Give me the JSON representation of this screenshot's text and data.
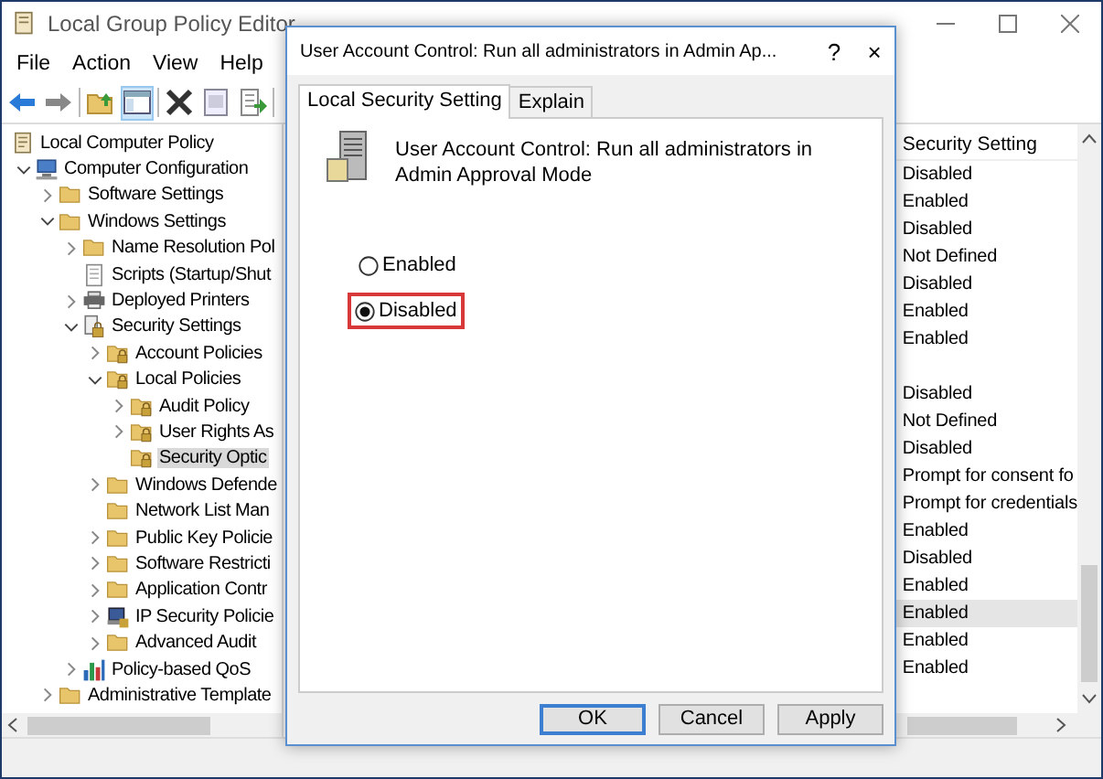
{
  "window": {
    "title": "Local Group Policy Editor"
  },
  "menu": [
    "File",
    "Action",
    "View",
    "Help"
  ],
  "toolbar": [
    {
      "kind": "back"
    },
    {
      "kind": "forward"
    },
    {
      "kind": "sep"
    },
    {
      "kind": "up"
    },
    {
      "kind": "tree",
      "selected": true
    },
    {
      "kind": "sep"
    },
    {
      "kind": "delete"
    },
    {
      "kind": "properties"
    },
    {
      "kind": "export"
    },
    {
      "kind": "sep"
    }
  ],
  "tree": [
    {
      "label": "Local Computer Policy",
      "kind": "policy",
      "selected": false,
      "children": [
        {
          "label": "Computer Configuration",
          "kind": "computer",
          "expanded": true,
          "selected": false,
          "children": [
            {
              "label": "Software Settings",
              "kind": "folder",
              "expanded": false,
              "selected": false
            },
            {
              "label": "Windows Settings",
              "kind": "folder",
              "expanded": true,
              "selected": false,
              "children": [
                {
                  "label": "Name Resolution Pol",
                  "kind": "folder",
                  "expanded": false,
                  "selected": false
                },
                {
                  "label": "Scripts (Startup/Shut",
                  "kind": "script",
                  "selected": false
                },
                {
                  "label": "Deployed Printers",
                  "kind": "printer",
                  "expanded": false,
                  "selected": false
                },
                {
                  "label": "Security Settings",
                  "kind": "lock-doc",
                  "expanded": true,
                  "selected": false,
                  "children": [
                    {
                      "label": "Account Policies",
                      "kind": "lock-folder",
                      "expanded": false,
                      "selected": false
                    },
                    {
                      "label": "Local Policies",
                      "kind": "lock-folder",
                      "expanded": true,
                      "selected": false,
                      "children": [
                        {
                          "label": "Audit Policy",
                          "kind": "lock-folder",
                          "expanded": false,
                          "selected": false
                        },
                        {
                          "label": "User Rights As",
                          "kind": "lock-folder",
                          "expanded": false,
                          "selected": false
                        },
                        {
                          "label": "Security Optic",
                          "kind": "lock-folder",
                          "selected": true
                        }
                      ]
                    },
                    {
                      "label": "Windows Defende",
                      "kind": "folder",
                      "expanded": false,
                      "selected": false
                    },
                    {
                      "label": "Network List Man",
                      "kind": "folder",
                      "selected": false
                    },
                    {
                      "label": "Public Key Policie",
                      "kind": "folder",
                      "expanded": false,
                      "selected": false
                    },
                    {
                      "label": "Software Restricti",
                      "kind": "folder",
                      "expanded": false,
                      "selected": false
                    },
                    {
                      "label": "Application Contr",
                      "kind": "folder",
                      "expanded": false,
                      "selected": false
                    },
                    {
                      "label": "IP Security Policie",
                      "kind": "ip",
                      "expanded": false,
                      "selected": false
                    },
                    {
                      "label": "Advanced Audit",
                      "kind": "folder",
                      "expanded": false,
                      "selected": false
                    }
                  ]
                },
                {
                  "label": "Policy-based QoS",
                  "kind": "qos",
                  "expanded": false,
                  "selected": false
                }
              ]
            },
            {
              "label": "Administrative Template",
              "kind": "folder",
              "expanded": false,
              "selected": false
            }
          ]
        }
      ]
    }
  ],
  "list": {
    "column": "Security Setting",
    "rows": [
      {
        "setting": "Disabled",
        "selected": false
      },
      {
        "setting": "Enabled",
        "selected": false
      },
      {
        "setting": "Disabled",
        "selected": false
      },
      {
        "setting": "Not Defined",
        "selected": false
      },
      {
        "setting": "Disabled",
        "selected": false
      },
      {
        "setting": "Enabled",
        "selected": false
      },
      {
        "setting": "Enabled",
        "selected": false
      },
      {
        "selected": false
      },
      {
        "setting": "Disabled",
        "selected": false
      },
      {
        "setting": "Not Defined",
        "selected": false
      },
      {
        "setting": "Disabled",
        "selected": false
      },
      {
        "setting": "Prompt for consent fo",
        "selected": false
      },
      {
        "setting": "Prompt for credentials",
        "selected": false
      },
      {
        "setting": "Enabled",
        "selected": false
      },
      {
        "setting": "Disabled",
        "selected": false
      },
      {
        "setting": "Enabled",
        "selected": false
      },
      {
        "setting": "Enabled",
        "selected": true
      },
      {
        "setting": "Enabled",
        "selected": false
      },
      {
        "setting": "Enabled",
        "selected": false
      }
    ]
  },
  "dialog": {
    "title": "User Account Control: Run all administrators in Admin Ap...",
    "help": "?",
    "close": "×",
    "tabs": [
      {
        "label": "Local Security Setting",
        "selected": true
      },
      {
        "label": "Explain",
        "selected": false
      }
    ],
    "policy": "User Account Control: Run all administrators in Admin Approval Mode",
    "options": [
      {
        "label": "Enabled",
        "selected": false,
        "highlighted": false
      },
      {
        "label": "Disabled",
        "selected": true,
        "highlighted": true
      }
    ],
    "buttons": [
      {
        "label": "OK",
        "default": true
      },
      {
        "label": "Cancel",
        "default": false
      },
      {
        "label": "Apply",
        "default": false
      }
    ]
  }
}
